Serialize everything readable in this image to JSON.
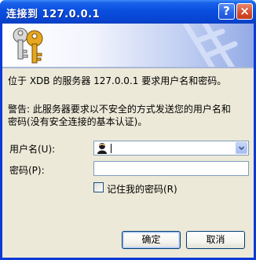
{
  "title_bar": {
    "title": "连接到 127.0.0.1",
    "help_label": "?",
    "close_label": "×"
  },
  "message": {
    "line1": "位于 XDB 的服务器 127.0.0.1 要求用户名和密码。",
    "warning_line1": "警告: 此服务器要求以不安全的方式发送您的用户名和",
    "warning_line2": "密码(没有安全连接的基本认证)。"
  },
  "form": {
    "username_label": "用户名(U):",
    "username_value": "",
    "password_label": "密码(P):",
    "password_value": "",
    "remember_label": "记住我的密码(R)",
    "remember_checked": false
  },
  "buttons": {
    "ok_label": "确定",
    "cancel_label": "取消"
  },
  "icons": {
    "banner": "keys-icon",
    "user": "user-icon",
    "dropdown": "chevron-down-icon"
  },
  "colors": {
    "title_bar": "#0a4fe0",
    "dialog_face": "#ece9d8",
    "field_border": "#7f9db9",
    "key_gold": "#e0a020"
  }
}
